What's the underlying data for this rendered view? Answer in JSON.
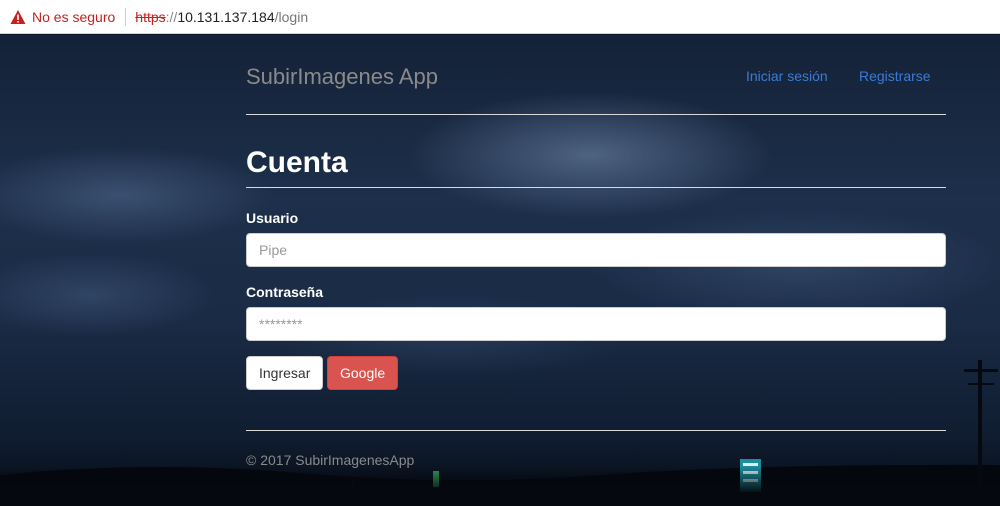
{
  "browser": {
    "security_text": "No es seguro",
    "url_scheme": "https",
    "url_separator": "://",
    "url_host": "10.131.137.184",
    "url_path": "/login"
  },
  "navbar": {
    "brand": "SubirImagenes App",
    "login_link": "Iniciar sesión",
    "register_link": "Registrarse"
  },
  "form": {
    "heading": "Cuenta",
    "user_label": "Usuario",
    "user_placeholder": "Pipe",
    "password_label": "Contraseña",
    "password_placeholder": "********",
    "submit_label": "Ingresar",
    "google_label": "Google"
  },
  "footer": {
    "copyright": "© 2017 SubirImagenesApp"
  },
  "colors": {
    "link": "#3a7bd5",
    "google_button": "#d9534f",
    "warning": "#c5221f"
  }
}
